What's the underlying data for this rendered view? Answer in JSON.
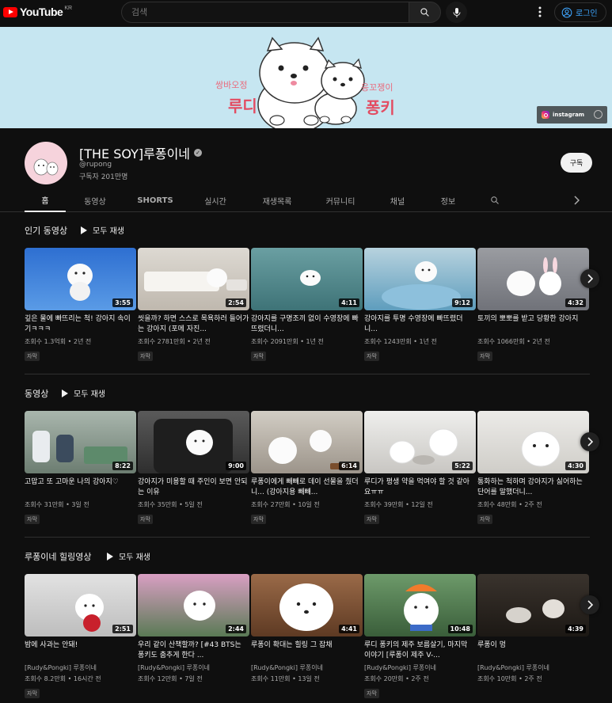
{
  "topbar": {
    "logo_text": "YouTube",
    "region": "KR",
    "search_placeholder": "검색",
    "login_label": "로그인"
  },
  "banner": {
    "left_small": "쌍바오정",
    "left_big": "루디",
    "right_small": "응꼬쟁이",
    "right_big": "퐁키",
    "instagram_label": "instagram"
  },
  "channel": {
    "name": "[THE SOY]루퐁이네",
    "handle": "@rupong",
    "subscribers": "구독자 201만명",
    "subscribe_label": "구독"
  },
  "tabs": [
    "홈",
    "동영상",
    "SHORTS",
    "실시간",
    "재생목록",
    "커뮤니티",
    "채널",
    "정보"
  ],
  "sections": [
    {
      "title": "인기 동영상",
      "play_all": "모두 재생",
      "videos": [
        {
          "title": "깊은 물에 빠뜨리는 척! 강아지 속이기ㅋㅋㅋ",
          "meta": "조회수 1.3억회 • 2년 전",
          "duration": "3:55",
          "badge": "자막",
          "color": "#3a73c9"
        },
        {
          "title": "씻을까? 하면 스스로 목욕하러 들어가는 강아지 (포메 자진...",
          "meta": "조회수 2781만회 • 2년 전",
          "duration": "2:54",
          "badge": "자막",
          "color": "#cfcac2"
        },
        {
          "title": "강아지를 구명조끼 없이 수영장에 빠뜨렸더니...",
          "meta": "조회수 2091만회 • 1년 전",
          "duration": "4:11",
          "badge": "자막",
          "color": "#4f8a8e"
        },
        {
          "title": "강아지를 투명 수영장에 빠뜨렸더니...",
          "meta": "조회수 1243만회 • 1년 전",
          "duration": "9:12",
          "badge": "자막",
          "color": "#7fb3cf"
        },
        {
          "title": "토끼의 뽀뽀를 받고 당황한 강아지",
          "meta": "조회수 1066만회 • 2년 전",
          "duration": "4:32",
          "badge": "자막",
          "color": "#8b8e95"
        }
      ]
    },
    {
      "title": "동영상",
      "play_all": "모두 재생",
      "videos": [
        {
          "title": "고맙고 또 고마운 나의 강아지♡",
          "meta": "조회수 31만회 • 3일 전",
          "duration": "8:22",
          "badge": "자막",
          "color": "#8d9e8f"
        },
        {
          "title": "강아지가 미용할 때 주인이 보면 안되는 이유",
          "meta": "조회수 35만회 • 5일 전",
          "duration": "9:00",
          "badge": "자막",
          "color": "#4a4a4a"
        },
        {
          "title": "루퐁이에게 빼빼로 데이 선물을 줬더니... (강아지용 빼빼...",
          "meta": "조회수 27만회 • 10일 전",
          "duration": "6:14",
          "badge": "자막",
          "color": "#b7b1a6"
        },
        {
          "title": "루디가 평생 약을 먹여야 할 것 같아요ㅠㅠ",
          "meta": "조회수 39만회 • 12일 전",
          "duration": "5:22",
          "badge": "자막",
          "color": "#d9d8d5"
        },
        {
          "title": "통화하는 척하며 강아지가 싫어하는 단어를 말했더니...",
          "meta": "조회수 48만회 • 2주 전",
          "duration": "4:30",
          "badge": "자막",
          "color": "#e3e1dd"
        }
      ]
    },
    {
      "title": "루퐁이네 힐링영상",
      "play_all": "모두 재생",
      "videos": [
        {
          "title": "밤에 사과는 안돼!",
          "channel": "[Rudy&Pongki] 루퐁이네",
          "meta": "조회수 8.2만회 • 16시간 전",
          "duration": "2:51",
          "badge": "자막",
          "color": "#dcdcdc"
        },
        {
          "title": "우리 같이 산책할까? [#43 BTS는 퐁키도 춤추게 한다 ...",
          "channel": "[Rudy&Pongki] 루퐁이네",
          "meta": "조회수 12만회 • 7일 전",
          "duration": "2:44",
          "badge": "",
          "color": "#9a8a9e"
        },
        {
          "title": "루퐁이 확대는 힐링 그 잡채",
          "channel": "[Rudy&Pongki] 루퐁이네",
          "meta": "조회수 11만회 • 13일 전",
          "duration": "4:41",
          "badge": "",
          "color": "#8a5b3f"
        },
        {
          "title": "루디 퐁키의 제주 보름살기, 마지막 이야기 [루퐁이 제주 V-...",
          "channel": "[Rudy&Pongki] 루퐁이네",
          "meta": "조회수 20만회 • 2주 전",
          "duration": "10:48",
          "badge": "자막",
          "color": "#4e7a52"
        },
        {
          "title": "루퐁이 멍",
          "channel": "[Rudy&Pongki] 루퐁이네",
          "meta": "조회수 10만회 • 2주 전",
          "duration": "4:39",
          "badge": "",
          "color": "#2f2a26"
        }
      ]
    }
  ]
}
